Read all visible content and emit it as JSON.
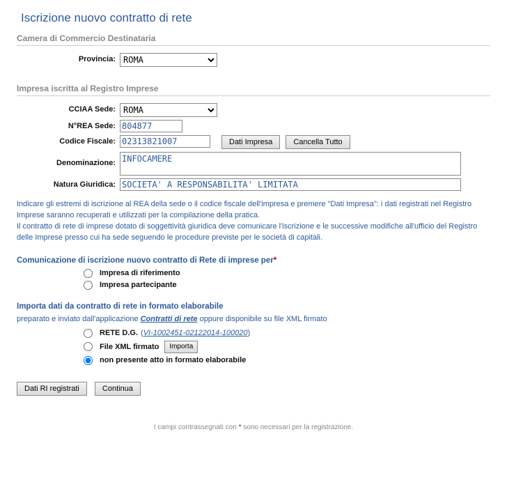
{
  "title": "Iscrizione nuovo contratto di rete",
  "section_camera": "Camera di Commercio Destinataria",
  "provincia_label": "Provincia:",
  "provincia_value": "ROMA",
  "section_impresa": "Impresa iscritta al Registro Imprese",
  "cciaa_label": "CCIAA Sede:",
  "cciaa_value": "ROMA",
  "nrea_label": "N°REA Sede:",
  "nrea_value": "804877",
  "cf_label": "Codice Fiscale:",
  "cf_value": "02313821007",
  "btn_dati_impresa": "Dati Impresa",
  "btn_cancella_tutto": "Cancella Tutto",
  "denom_label": "Denominazione:",
  "denom_value": "INFOCAMERE",
  "natura_label": "Natura Giuridica:",
  "natura_value": "SOCIETA' A RESPONSABILITA' LIMITATA",
  "info1": "Indicare gli estremi di iscrizione al REA della sede o il codice fiscale dell'impresa e premere \"Dati Impresa\": i dati registrati nel Registro Imprese saranno recuperati e utilizzati per la compilazione della pratica.",
  "info2": "Il contratto di rete di imprese dotato di soggettività giuridica deve comunicare l'iscrizione e le successive modifiche all'ufficio del Registro delle Imprese presso cui ha sede seguendo le procedure previste per le società di capitali.",
  "comunicazione_heading": "Comunicazione di iscrizione nuovo contratto di Rete di imprese per",
  "radio_riferimento": "Impresa di riferimento",
  "radio_partecipante": "Impresa partecipante",
  "importa_heading": "Importa dati da contratto di rete in formato elaborabile",
  "importa_note_pre": "preparato e inviato dall'applicazione ",
  "importa_note_link": "Contratti di rete",
  "importa_note_post": " oppure disponibile su file XML firmato",
  "radio_rete_label": "RETE D.G.",
  "radio_rete_link": "VI-1002451-02122014-100020",
  "radio_xml": "File XML firmato",
  "btn_importa": "Importa",
  "radio_nonpresente": "non presente atto in formato elaborabile",
  "btn_dati_ri": "Dati RI registrati",
  "btn_continua": "Continua",
  "footer_pre": "I campi contrassegnati con ",
  "footer_post": " sono necessari per la registrazione."
}
